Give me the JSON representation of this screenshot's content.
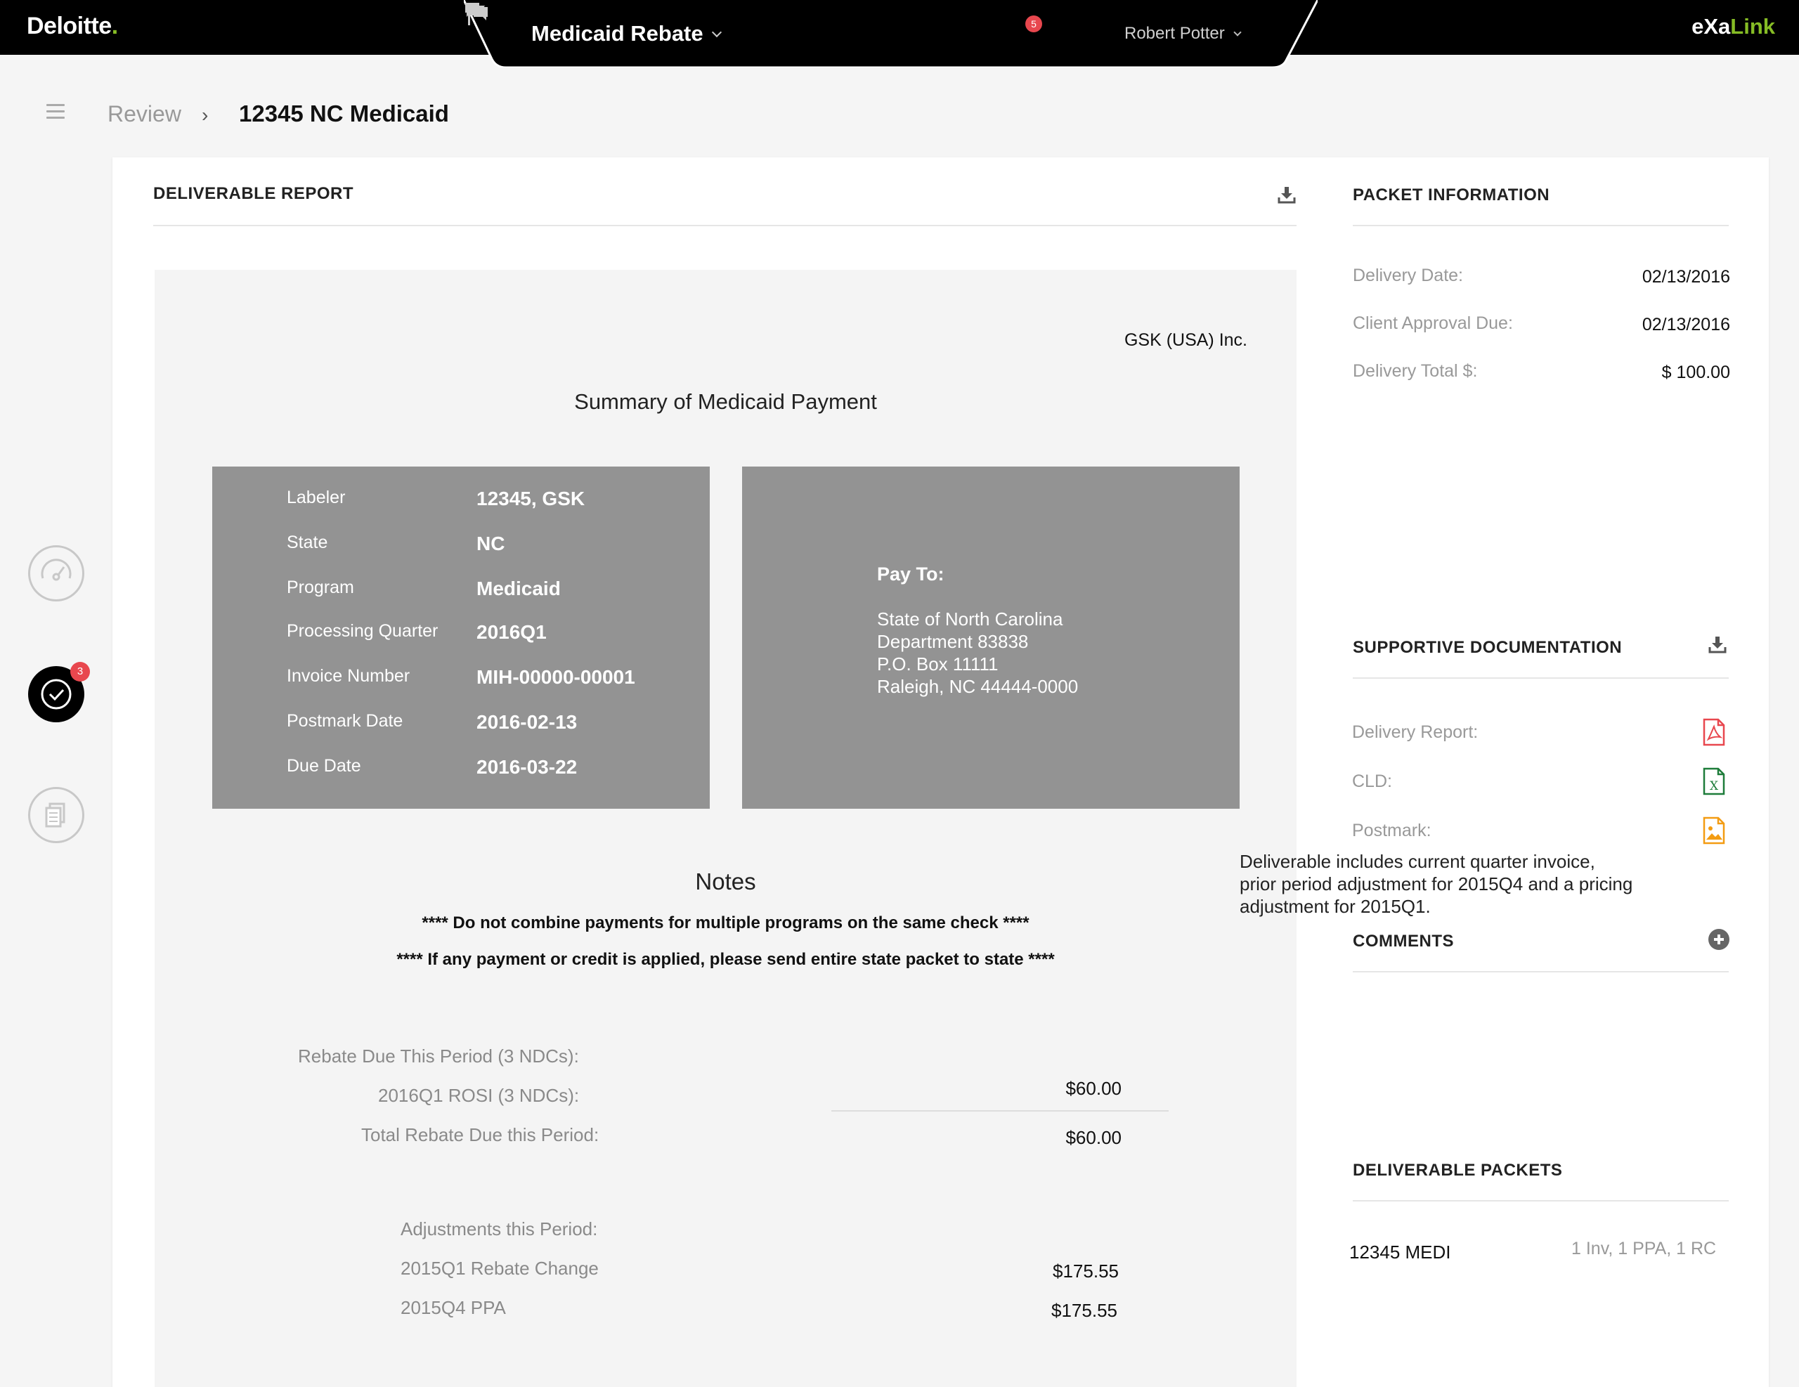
{
  "topbar": {
    "brand": "Deloitte",
    "brand_dot": ".",
    "app_title": "Medicaid Rebate",
    "flag_count": "5",
    "user_name": "Robert Potter",
    "product_part1": "eXa",
    "product_part2": "Link"
  },
  "breadcrumb": {
    "parent": "Review",
    "separator": "›",
    "current": "12345 NC Medicaid"
  },
  "rail": {
    "review_badge": "3"
  },
  "report": {
    "header": "DELIVERABLE REPORT",
    "company": "GSK (USA) Inc.",
    "title": "Summary of Medicaid Payment",
    "fields": [
      {
        "label": "Labeler",
        "value": "12345, GSK"
      },
      {
        "label": "State",
        "value": "NC"
      },
      {
        "label": "Program",
        "value": "Medicaid"
      },
      {
        "label": "Processing Quarter",
        "value": "2016Q1"
      },
      {
        "label": "Invoice Number",
        "value": "MIH-00000-00001"
      },
      {
        "label": "Postmark Date",
        "value": "2016-02-13"
      },
      {
        "label": "Due Date",
        "value": "2016-03-22"
      }
    ],
    "pay_to": {
      "label": "Pay To:",
      "lines": [
        "State of North Carolina",
        "Department 83838",
        "P.O. Box 11111",
        "Raleigh, NC 44444-0000"
      ]
    },
    "notes_title": "Notes",
    "notes": [
      "**** Do not combine payments for multiple programs on the same check ****",
      "**** If any payment or credit is applied, please send entire state packet to state ****"
    ],
    "rebate": {
      "due_label": "Rebate Due This Period (3 NDCs):",
      "rosi_label": "2016Q1 ROSI (3 NDCs):",
      "rosi_value": "$60.00",
      "total_label": "Total Rebate Due this Period:",
      "total_value": "$60.00",
      "adj_label": "Adjustments this Period:",
      "adj1_label": "2015Q1 Rebate Change",
      "adj1_value": "$175.55",
      "adj2_label": "2015Q4 PPA",
      "adj2_value": "$175.55"
    }
  },
  "packet": {
    "header": "PACKET INFORMATION",
    "delivery_date_label": "Delivery Date:",
    "delivery_date": "02/13/2016",
    "approval_label": "Client Approval Due:",
    "approval_date": "02/13/2016",
    "total_label": "Delivery Total $:",
    "total_value": "$ 100.00"
  },
  "docs": {
    "header": "SUPPORTIVE DOCUMENTATION",
    "items": [
      {
        "label": "Delivery Report:",
        "icon": "pdf-file-icon",
        "color": "#e8474e"
      },
      {
        "label": "CLD:",
        "icon": "excel-file-icon",
        "color": "#1e7c3a"
      },
      {
        "label": "Postmark:",
        "icon": "image-file-icon",
        "color": "#f39c12"
      }
    ]
  },
  "comments": {
    "header": "COMMENTS",
    "text": "Deliverable includes current quarter invoice, prior period adjustment for 2015Q4 and a pricing adjustment for 2015Q1."
  },
  "packets": {
    "header": "DELIVERABLE PACKETS",
    "items": [
      {
        "name": "12345 MEDI",
        "summary": "1 Inv, 1 PPA, 1 RC"
      }
    ]
  },
  "colors": {
    "accent_green": "#86bc25",
    "badge_red": "#e8474e",
    "panel_gray": "#939393"
  }
}
